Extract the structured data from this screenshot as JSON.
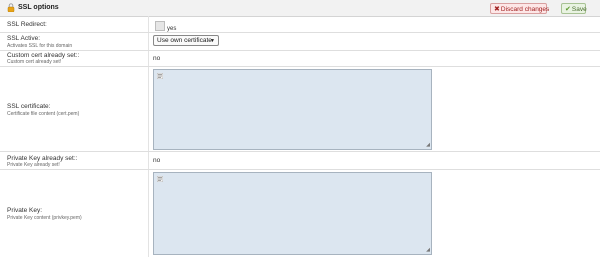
{
  "header": {
    "title": "SSL options",
    "discard_label": "Discard changes",
    "save_label": "Save"
  },
  "ssl_redirect": {
    "label": "SSL Redirect:",
    "checkbox_label": "yes",
    "checked": false
  },
  "ssl_active": {
    "label": "SSL Active:",
    "description": "Activates SSL for this domain",
    "selected": "Use own certificate"
  },
  "custom_cert_set": {
    "label": "Custom cert already set::",
    "description": "Custom cert already set!",
    "value": "no"
  },
  "ssl_certificate": {
    "label": "SSL certificate:",
    "description": "Certificate file content (cert.pem)",
    "value": ""
  },
  "private_key_set": {
    "label": "Private Key already set::",
    "description": "Private Key already set!",
    "value": "no"
  },
  "private_key": {
    "label": "Private Key:",
    "description": "Private Key content (privkey.pem)",
    "value": ""
  },
  "colors": {
    "discard": "#a12020",
    "save": "#4a6d2e",
    "textarea_bg": "#dce6f0"
  }
}
